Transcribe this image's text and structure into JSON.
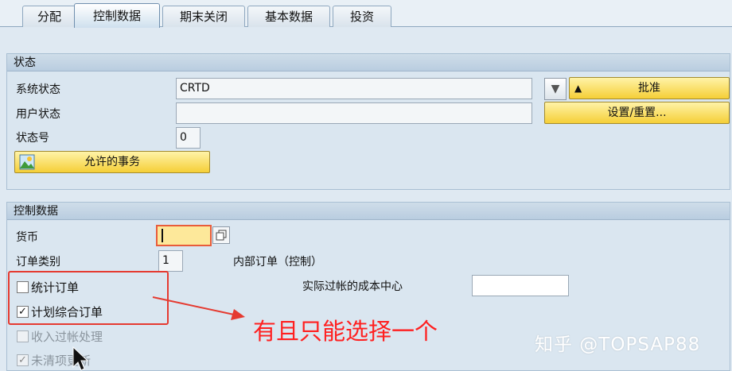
{
  "tabs": [
    {
      "label": "分配",
      "active": false
    },
    {
      "label": "控制数据",
      "active": true
    },
    {
      "label": "期末关闭",
      "active": false
    },
    {
      "label": "基本数据",
      "active": false
    },
    {
      "label": "投资",
      "active": false
    }
  ],
  "status_group": {
    "title": "状态",
    "system_status_label": "系统状态",
    "system_status_value": "CRTD",
    "user_status_label": "用户状态",
    "user_status_value": "",
    "status_number_label": "状态号",
    "status_number_value": "0",
    "allowed_transactions_button": "允许的事务",
    "approve_button": "批准",
    "set_reset_button": "设置/重置..."
  },
  "control_group": {
    "title": "控制数据",
    "currency_label": "货币",
    "currency_value": "",
    "order_category_label": "订单类别",
    "order_category_value": "1",
    "order_category_text": "内部订单（控制）",
    "actual_posted_cc_label": "实际过帐的成本中心",
    "actual_posted_cc_value": "",
    "checkboxes": [
      {
        "label": "统计订单",
        "checked": false,
        "enabled": true
      },
      {
        "label": "计划综合订单",
        "checked": true,
        "enabled": true
      },
      {
        "label": "收入过帐处理",
        "checked": false,
        "enabled": false
      },
      {
        "label": "未清项更新",
        "checked": true,
        "enabled": false
      }
    ]
  },
  "annotation": {
    "text": "有且只能选择一个",
    "color": "#ff2020"
  },
  "watermark": "知乎 @TOPSAP88",
  "colors": {
    "button_yellow": "#f5cf37",
    "background": "#dfe9f2",
    "highlight_red": "#e53a30"
  }
}
